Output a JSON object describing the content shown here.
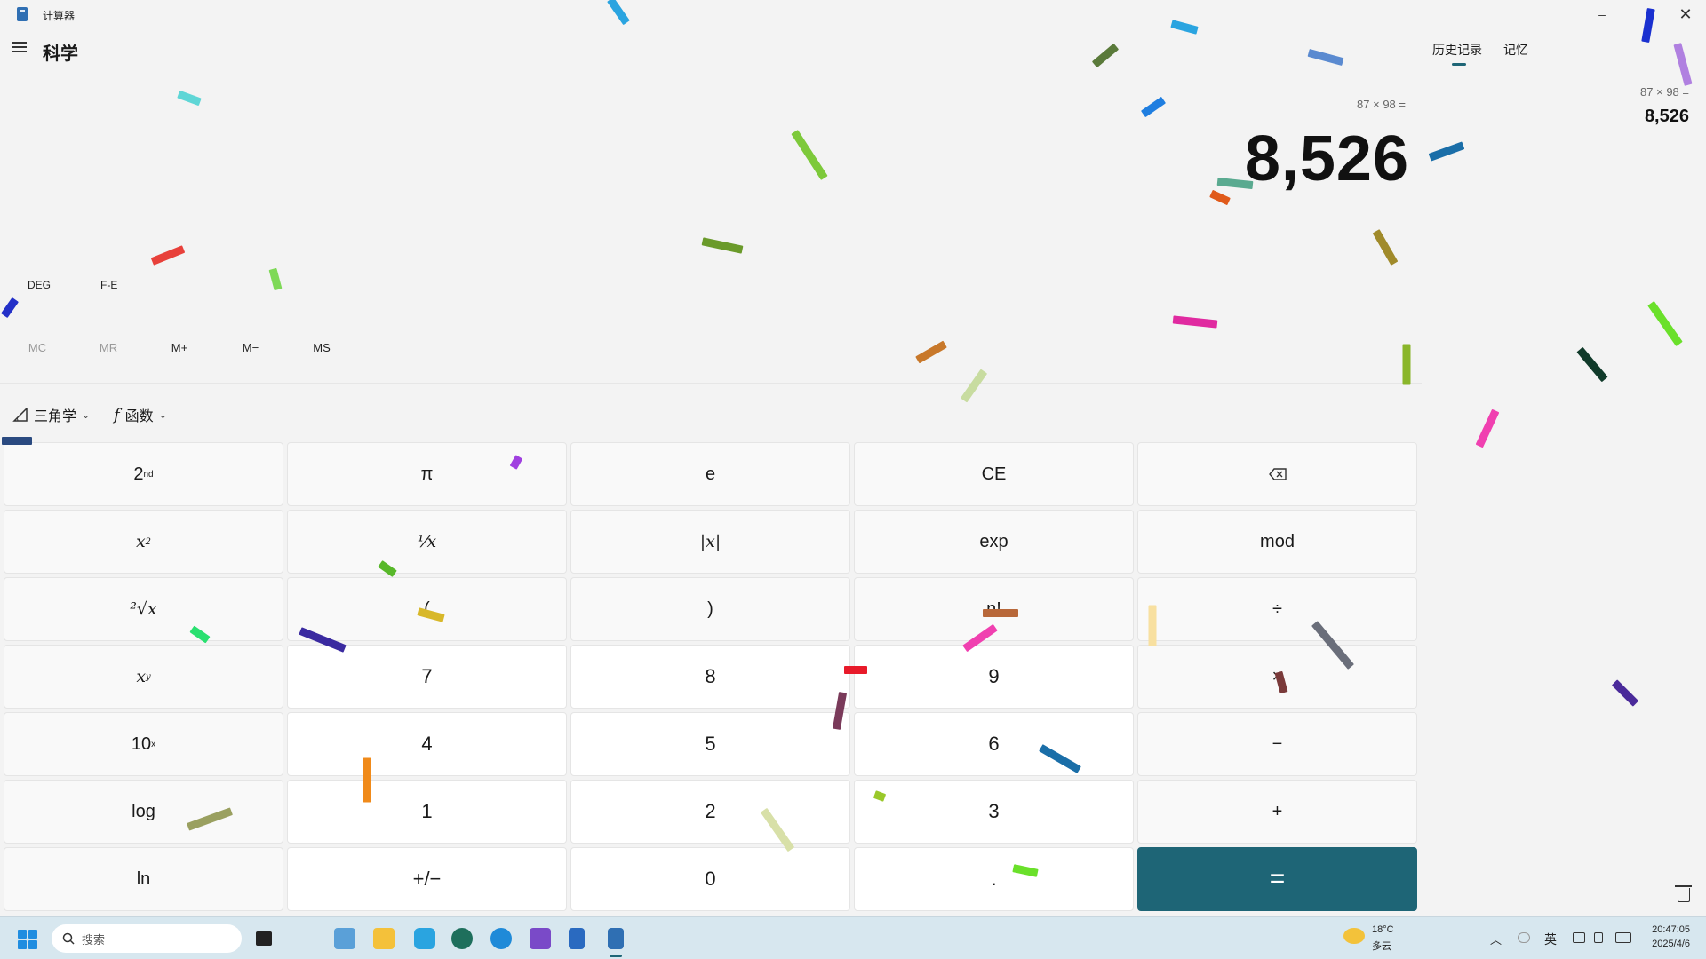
{
  "window": {
    "title": "计算器",
    "minimize": "–",
    "close": "✕"
  },
  "header": {
    "mode": "科学",
    "tabs": {
      "history": "历史记录",
      "memory": "记忆"
    }
  },
  "display": {
    "expression": "87 × 98 =",
    "result": "8,526"
  },
  "history": {
    "items": [
      {
        "expression": "87  ×  98 =",
        "result": "8,526"
      }
    ]
  },
  "modes": {
    "angle": "DEG",
    "fe": "F-E"
  },
  "memory": {
    "buttons": [
      "MC",
      "MR",
      "M+",
      "M−",
      "MS"
    ],
    "disabled": [
      "MC",
      "MR"
    ]
  },
  "functions": {
    "trig": "三角学",
    "func": "函数",
    "func_glyph": "f"
  },
  "keypad": {
    "rows": [
      [
        "2nd",
        "π",
        "e",
        "CE",
        "⌫"
      ],
      [
        "x²",
        "¹⁄x",
        "|x|",
        "exp",
        "mod"
      ],
      [
        "²√x",
        "(",
        ")",
        "n!",
        "÷"
      ],
      [
        "xʸ",
        "7",
        "8",
        "9",
        "×"
      ],
      [
        "10ˣ",
        "4",
        "5",
        "6",
        "−"
      ],
      [
        "log",
        "1",
        "2",
        "3",
        "+"
      ],
      [
        "ln",
        "+/−",
        "0",
        ".",
        "="
      ]
    ]
  },
  "taskbar": {
    "search_placeholder": "搜索",
    "weather_temp": "18°C",
    "weather_cond": "多云",
    "ime": "英",
    "time": "20:47:05",
    "date": "2025/4/6"
  },
  "colors": {
    "accent": "#1e6576",
    "background": "#f3f3f3",
    "taskbar": "#d7e7ef"
  }
}
